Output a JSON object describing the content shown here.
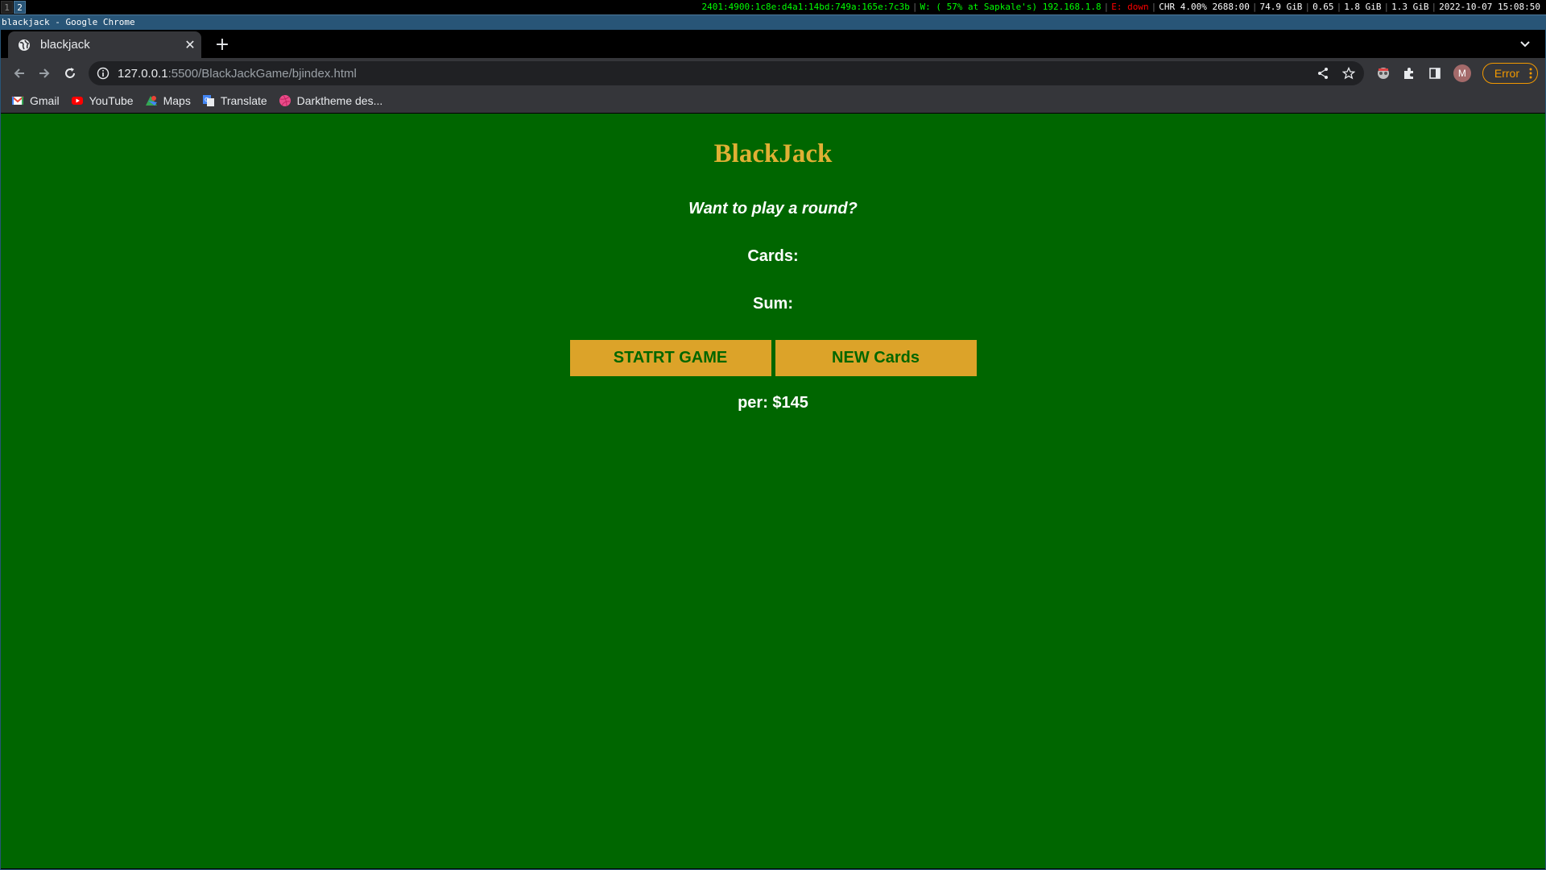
{
  "statusbar": {
    "workspaces": [
      "1",
      "2"
    ],
    "ipv6": "2401:4900:1c8e:d4a1:14bd:749a:165e:7c3b",
    "wifi": "W: ( 57% at Sapkale's) 192.168.1.8",
    "ethernet": "E: down",
    "cpu": "CHR 4.00% 2688:00",
    "disk": "74.9 GiB",
    "load": "0.65",
    "mem": "1.8 GiB",
    "swap": "1.3 GiB",
    "datetime": "2022-10-07 15:08:50",
    "colors": {
      "ok": "#00ff00",
      "bad": "#ff0000"
    }
  },
  "window": {
    "title": "blackjack - Google Chrome"
  },
  "browser": {
    "tab": {
      "title": "blackjack",
      "close": "✕",
      "favicon": "globe-icon"
    },
    "new_tab": "+",
    "url_host": "127.0.0.1",
    "url_rest": ":5500/BlackJackGame/bjindex.html",
    "avatar_letter": "M",
    "error_label": "Error",
    "bookmarks": [
      {
        "label": "Gmail",
        "icon": "gmail-icon"
      },
      {
        "label": "YouTube",
        "icon": "youtube-icon"
      },
      {
        "label": "Maps",
        "icon": "maps-icon"
      },
      {
        "label": "Translate",
        "icon": "translate-icon"
      },
      {
        "label": "Darktheme des...",
        "icon": "dribbble-icon"
      }
    ]
  },
  "game": {
    "title": "BlackJack",
    "message": "Want to play a round?",
    "cards_label": "Cards:",
    "sum_label": "Sum:",
    "start_button": "STATRT GAME",
    "new_card_button": "NEW Cards",
    "player": "per: $145",
    "colors": {
      "background": "#006600",
      "title": "#e0b034",
      "button": "#dca329",
      "button_text": "#016600"
    }
  }
}
